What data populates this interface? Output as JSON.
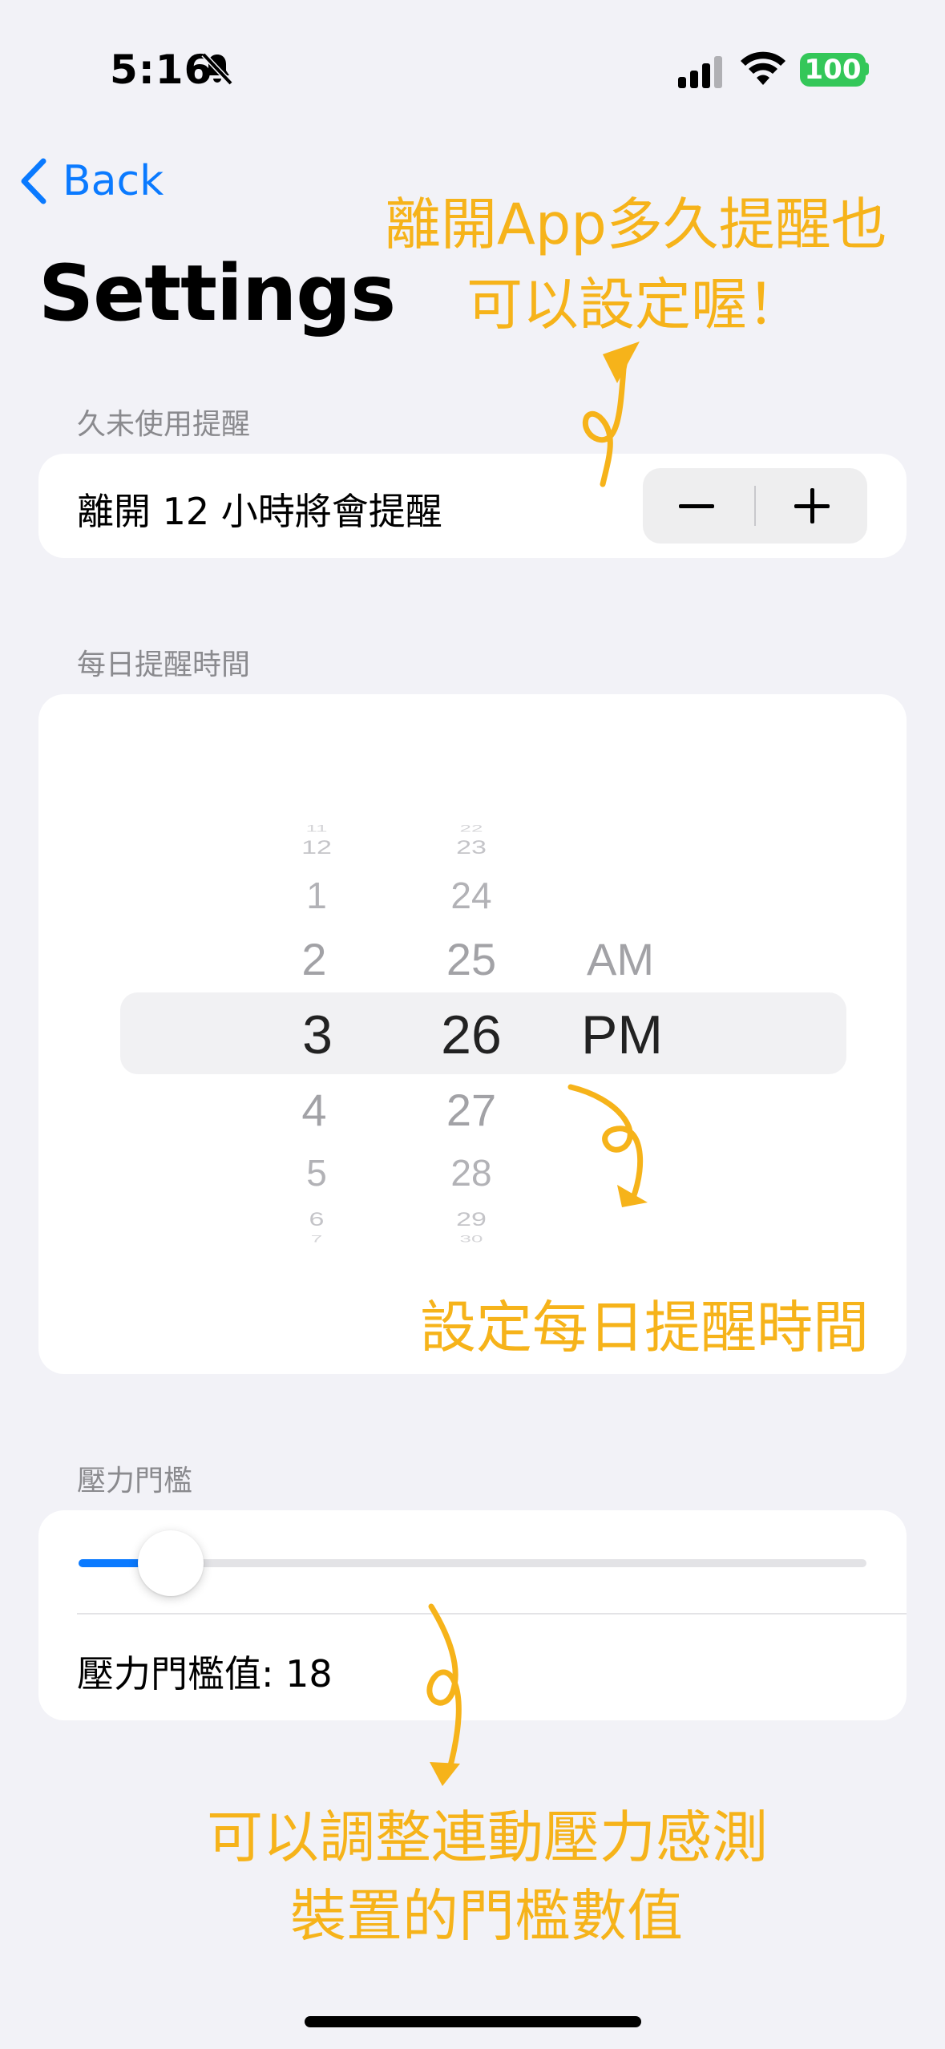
{
  "status_bar": {
    "time": "5:16",
    "battery": "100"
  },
  "nav": {
    "back_label": "Back",
    "title": "Settings"
  },
  "inactivity": {
    "section_label": "久未使用提醒",
    "row_text": "離開 12 小時將會提醒",
    "stepper_minus": "−",
    "stepper_plus": "+"
  },
  "daily": {
    "section_label": "每日提醒時間",
    "picker": {
      "hours": [
        "11",
        "12",
        "1",
        "2",
        "3",
        "4",
        "5",
        "6",
        "7"
      ],
      "minutes": [
        "22",
        "23",
        "24",
        "25",
        "26",
        "27",
        "28",
        "29",
        "30"
      ],
      "periods": [
        "AM",
        "PM"
      ],
      "selected": {
        "hour": "3",
        "minute": "26",
        "period": "PM"
      }
    }
  },
  "stress": {
    "section_label": "壓力門檻",
    "slider_value_fraction": 0.08,
    "value_label": "壓力門檻值: 18"
  },
  "annotations": {
    "top_line1": "離開App多久提醒也",
    "top_line2": "可以設定喔！",
    "middle": "設定每日提醒時間",
    "bottom_line1": "可以調整連動壓力感測",
    "bottom_line2": "裝置的門檻數值"
  },
  "colors": {
    "accent": "#0a7aff",
    "annotation": "#f6b31a",
    "battery": "#34c759"
  }
}
